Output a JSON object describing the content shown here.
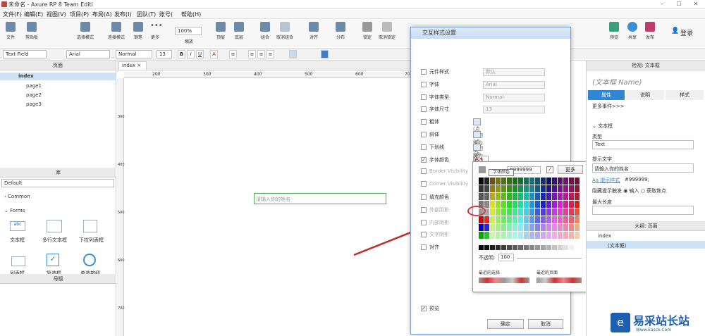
{
  "window": {
    "title": "未命名 - Axure RP 8 Team Editi"
  },
  "menu": [
    "文件(F)",
    "编辑(E)",
    "视图(V)",
    "项目(P)",
    "布局(A)",
    "发布(I)",
    "团队(T)",
    "账号(",
    "帮助(H)"
  ],
  "toolbar": {
    "items": [
      "文件",
      "剪贴板",
      "选择模式",
      "连接模式",
      "钢笔",
      "更多"
    ],
    "zoom": "100%",
    "zoom_label": "缩放",
    "right_items": [
      "顶层",
      "底层",
      "组合",
      "取消组合",
      "对齐",
      "分布",
      "锁定",
      "取消锁定",
      "预览",
      "共享",
      "发布"
    ],
    "login": "登录"
  },
  "format": {
    "widget": "Text Field",
    "font": "Arial",
    "style": "Normal",
    "size": "13"
  },
  "left": {
    "pages_title": "页面",
    "pages": [
      "index",
      "page1",
      "page2",
      "page3"
    ],
    "library_title": "库",
    "library_select": "Default",
    "common": "Common",
    "forms": "Forms",
    "widgets": [
      "文本框",
      "多行文本框",
      "下拉列表框",
      "列表框",
      "复选框",
      "单选按钮"
    ],
    "masters_title": "母版"
  },
  "canvas": {
    "tab": "index",
    "ruler_h": [
      "200",
      "300",
      "400",
      "500",
      "600",
      "700"
    ],
    "ruler_v": [
      "300",
      "400",
      "500",
      "600",
      "700"
    ],
    "placeholder": "请输入你的姓名"
  },
  "dialog": {
    "title": "交互样式设置",
    "rows": [
      {
        "label": "元件样式",
        "value": "默认"
      },
      {
        "label": "字体",
        "value": "Arial"
      },
      {
        "label": "字体类型",
        "value": "Normal"
      },
      {
        "label": "字体尺寸",
        "value": "13"
      },
      {
        "label": "粗体",
        "value": "(点击切换为粗体)"
      },
      {
        "label": "斜体",
        "value": "(点击切换为斜体)"
      },
      {
        "label": "下划线",
        "value": "(点击切换为下划线)"
      },
      {
        "label": "字体颜色",
        "value": ""
      },
      {
        "label": "Border Visibility",
        "value": ""
      },
      {
        "label": "Corner Visibility",
        "value": ""
      },
      {
        "label": "填充颜色",
        "value": ""
      },
      {
        "label": "外部阴影",
        "value": ""
      },
      {
        "label": "内部阴影",
        "value": ""
      },
      {
        "label": "文字阴影",
        "value": ""
      },
      {
        "label": "对齐",
        "value": ""
      }
    ],
    "preview": "预览",
    "ok": "确定",
    "cancel": "取消"
  },
  "picker": {
    "tooltip": "字体颜色",
    "hex": "#999999",
    "more": "更多",
    "opacity_label": "不透明:",
    "opacity": "100",
    "recent_selected": "最近的选择",
    "recent_page": "最近的页面"
  },
  "right": {
    "title": "检视: 文本框",
    "name_placeholder": "(文本框 Name)",
    "tabs": [
      "属性",
      "说明",
      "样式"
    ],
    "more_events": "更多事件>>>",
    "section": "文本框",
    "type_label": "类型",
    "type_value": "Text",
    "hint_label": "提示文字",
    "hint_value": "请输入你的姓名",
    "hint_style_link": "提示样式",
    "hint_color": "#999999;",
    "hide_label": "隐藏提示触发",
    "radio1": "输入",
    "radio2": "获取焦点",
    "maxlen": "最大长度",
    "outline_title": "大纲: 页面",
    "outline_root": "index",
    "outline_item": "(文本框)"
  },
  "watermark": {
    "text": "易采站长站",
    "sub": "Www.Easck.Com"
  }
}
